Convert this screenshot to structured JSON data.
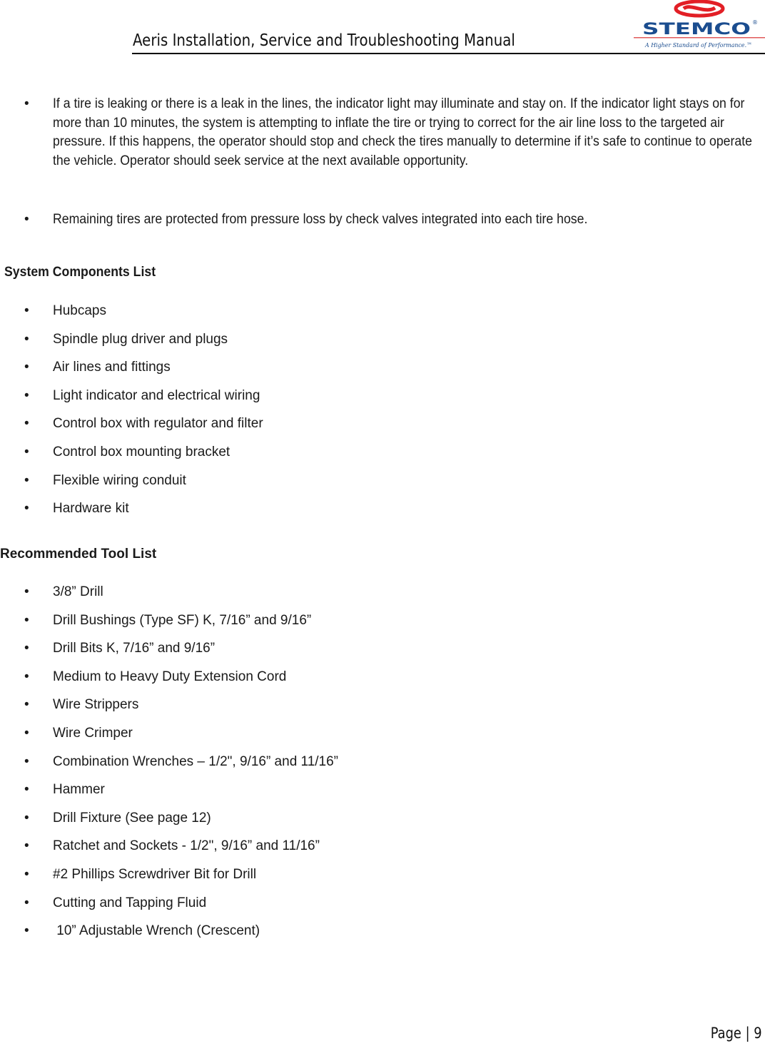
{
  "header": {
    "title": "Aeris Installation, Service and Troubleshooting Manual",
    "logo": {
      "brand": "STEMCO",
      "registered_mark": "®",
      "tagline": "A Higher Standard of Performance.™",
      "colors": {
        "swoosh": "#e21f26",
        "brand_text": "#1b4d8f",
        "rule": "#e05a5a",
        "tagline": "#1b4d8f"
      }
    }
  },
  "intro_bullets": [
    {
      "bullet": "•",
      "text": "If a tire is leaking or there is a leak in the lines, the indicator light may illuminate and stay on.  If the indicator light stays on for more than 10 minutes, the system is attempting to inflate the tire or trying to correct for the air line loss to the targeted air pressure.  If this happens, the operator should stop and check the tires manually to determine if it’s safe to continue to operate the vehicle.   Operator should seek service at the next available opportunity."
    },
    {
      "bullet": "•",
      "text": "Remaining tires are protected from pressure loss by check valves integrated into each tire hose."
    }
  ],
  "components": {
    "heading": "System Components List",
    "items": [
      "Hubcaps",
      "Spindle plug driver and plugs",
      "Air lines and fittings",
      "Light indicator and electrical wiring",
      "Control box with regulator and filter",
      "Control box mounting bracket",
      "Flexible wiring conduit",
      "Hardware kit"
    ]
  },
  "tools": {
    "heading": "Recommended Tool List",
    "items": [
      "3/8” Drill",
      "Drill Bushings (Type SF)  K, 7/16” and 9/16”",
      "Drill Bits  K, 7/16” and 9/16”",
      "Medium to Heavy Duty Extension Cord",
      "Wire Strippers",
      "Wire Crimper",
      "Combination Wrenches – 1/2\", 9/16” and 11/16”",
      "Hammer",
      "Drill Fixture (See page 12)",
      "Ratchet and Sockets -  1/2\", 9/16” and 11/16”",
      "#2 Phillips Screwdriver Bit for Drill",
      "Cutting and Tapping Fluid",
      " 10” Adjustable Wrench (Crescent)"
    ]
  },
  "bullet_glyph": "•",
  "footer": {
    "page_label": "Page | 9"
  }
}
